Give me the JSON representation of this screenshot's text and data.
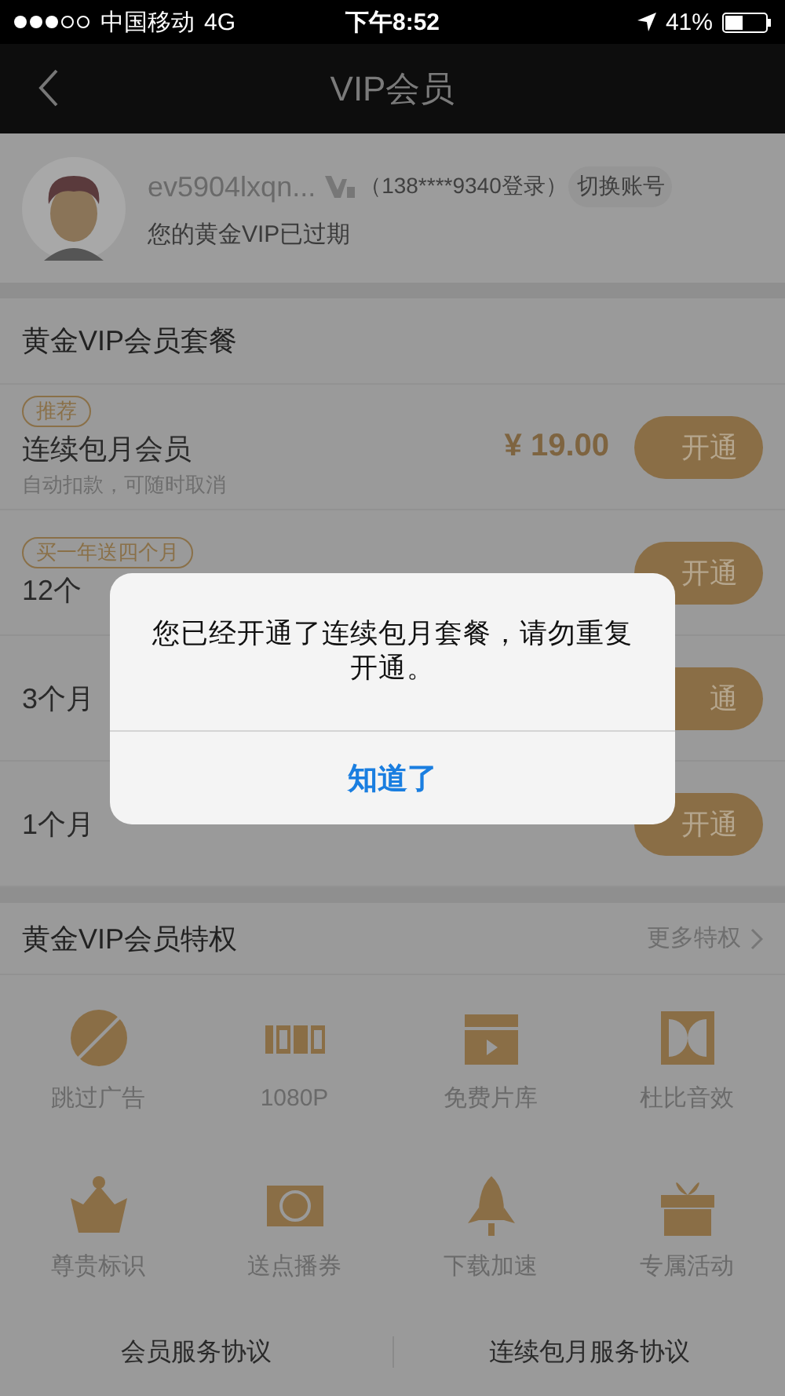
{
  "status_bar": {
    "carrier": "中国移动",
    "network": "4G",
    "time": "下午8:52",
    "battery": "41%"
  },
  "nav": {
    "title": "VIP会员"
  },
  "user": {
    "name": "ev5904lxqn...",
    "login": "（138****9340登录）",
    "switch": "切换账号",
    "status": "您的黄金VIP已过期"
  },
  "packages": {
    "title": "黄金VIP会员套餐",
    "items": [
      {
        "tag": "推荐",
        "name": "连续包月会员",
        "subtitle": "自动扣款，可随时取消",
        "price": "¥ 19.00",
        "button": "开通"
      },
      {
        "tag": "买一年送四个月",
        "name": "12个",
        "button": "开通"
      },
      {
        "name": "3个月",
        "button": "通"
      },
      {
        "name": "1个月",
        "button": "开通"
      }
    ]
  },
  "privileges": {
    "title": "黄金VIP会员特权",
    "more": "更多特权",
    "items": [
      {
        "kind": "ad",
        "label": "跳过广告"
      },
      {
        "kind": "hd",
        "label": "1080P"
      },
      {
        "kind": "film",
        "label": "免费片库"
      },
      {
        "kind": "dolby",
        "label": "杜比音效"
      },
      {
        "kind": "crown",
        "label": "尊贵标识"
      },
      {
        "kind": "ticket",
        "label": "送点播券"
      },
      {
        "kind": "rocket",
        "label": "下载加速"
      },
      {
        "kind": "gift",
        "label": "专属活动"
      }
    ]
  },
  "footer": {
    "links": [
      "会员服务协议",
      "连续包月服务协议"
    ]
  },
  "dialog": {
    "message": "您已经开通了连续包月套餐，请勿重复开通。",
    "button": "知道了"
  }
}
